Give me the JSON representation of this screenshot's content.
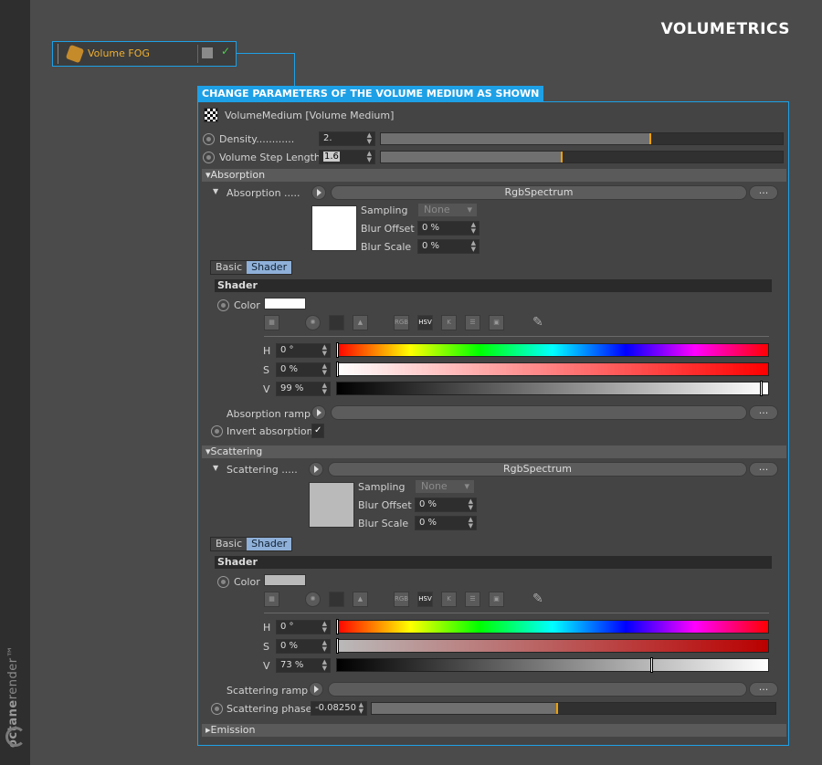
{
  "brand": {
    "name_a": "octane",
    "name_b": "render",
    "tm": "™"
  },
  "title": "VOLUMETRICS",
  "node": {
    "label": "Volume FOG",
    "check": "✓"
  },
  "banner": "CHANGE PARAMETERS OF THE VOLUME MEDIUM AS SHOWN",
  "medium": {
    "name": "VolumeMedium [Volume Medium]"
  },
  "density": {
    "label": "Density",
    "dots": "............",
    "value": "2.",
    "slider_fraction": 0.67
  },
  "step": {
    "label": "Volume Step Length",
    "value": "1.6",
    "slider_fraction": 0.45
  },
  "absorption": {
    "section": "Absorption",
    "label": "Absorption",
    "dots": ".....",
    "spectrum": "RgbSpectrum",
    "more": "...",
    "sampling_label": "Sampling",
    "sampling_value": "None",
    "blur_offset_label": "Blur Offset",
    "blur_offset_value": "0 %",
    "blur_scale_label": "Blur Scale",
    "blur_scale_value": "0 %",
    "swatch_color": "#ffffff",
    "tab_basic": "Basic",
    "tab_shader": "Shader",
    "shader_header": "Shader",
    "color_label": "Color",
    "h_label": "H",
    "h_value": "0 °",
    "s_label": "S",
    "s_value": "0 %",
    "v_label": "V",
    "v_value": "99 %",
    "v_fraction": 0.99,
    "ramp_label": "Absorption ramp",
    "invert_label": "Invert absorption",
    "invert_check": "✓"
  },
  "scattering": {
    "section": "Scattering",
    "label": "Scattering",
    "dots": ".....",
    "spectrum": "RgbSpectrum",
    "more": "...",
    "sampling_label": "Sampling",
    "sampling_value": "None",
    "blur_offset_label": "Blur Offset",
    "blur_offset_value": "0 %",
    "blur_scale_label": "Blur Scale",
    "blur_scale_value": "0 %",
    "swatch_color": "#bababa",
    "tab_basic": "Basic",
    "tab_shader": "Shader",
    "shader_header": "Shader",
    "color_label": "Color",
    "h_label": "H",
    "h_value": "0 °",
    "s_label": "S",
    "s_value": "0 %",
    "v_label": "V",
    "v_value": "73 %",
    "v_fraction": 0.73,
    "ramp_label": "Scattering ramp",
    "phase_label": "Scattering phase",
    "phase_value": "-0.08250",
    "phase_fraction": 0.46
  },
  "emission": {
    "section": "Emission"
  },
  "toolbar": {
    "rgb": "RGB",
    "hsv": "HSV",
    "k": "K"
  },
  "colors": {
    "accent": "#1ea0e6",
    "marker": "#f0a000",
    "node_label": "#f0b030"
  }
}
